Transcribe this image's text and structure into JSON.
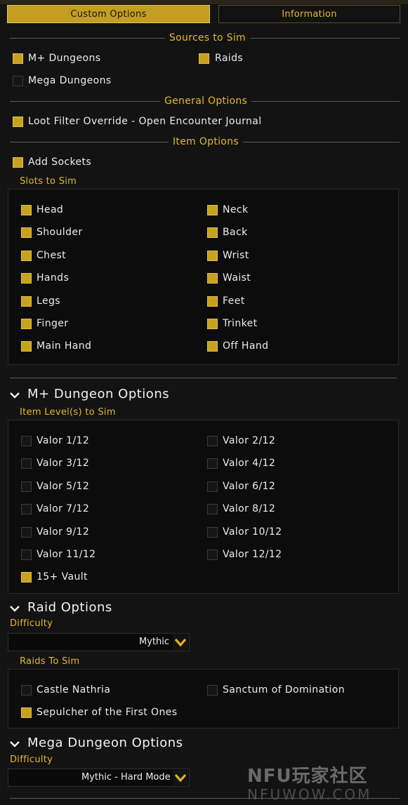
{
  "tabs": {
    "custom_options": "Custom Options",
    "information": "Information"
  },
  "sources": {
    "title": "Sources to Sim",
    "mplus": {
      "label": "M+ Dungeons",
      "checked": true
    },
    "raids": {
      "label": "Raids",
      "checked": true
    },
    "mega": {
      "label": "Mega Dungeons",
      "checked": false
    }
  },
  "general": {
    "title": "General Options",
    "loot_filter": {
      "label": "Loot Filter Override - Open Encounter Journal",
      "checked": true
    }
  },
  "item_options": {
    "title": "Item Options",
    "add_sockets": {
      "label": "Add Sockets",
      "checked": true
    },
    "slots_title": "Slots to Sim",
    "slots": [
      {
        "label": "Head",
        "checked": true
      },
      {
        "label": "Neck",
        "checked": true
      },
      {
        "label": "Shoulder",
        "checked": true
      },
      {
        "label": "Back",
        "checked": true
      },
      {
        "label": "Chest",
        "checked": true
      },
      {
        "label": "Wrist",
        "checked": true
      },
      {
        "label": "Hands",
        "checked": true
      },
      {
        "label": "Waist",
        "checked": true
      },
      {
        "label": "Legs",
        "checked": true
      },
      {
        "label": "Feet",
        "checked": true
      },
      {
        "label": "Finger",
        "checked": true
      },
      {
        "label": "Trinket",
        "checked": true
      },
      {
        "label": "Main Hand",
        "checked": true
      },
      {
        "label": "Off Hand",
        "checked": true
      }
    ]
  },
  "mplus_options": {
    "title": "M+ Dungeon Options",
    "ilvl_title": "Item Level(s) to Sim",
    "levels": [
      {
        "label": "Valor 1/12",
        "checked": false
      },
      {
        "label": "Valor 2/12",
        "checked": false
      },
      {
        "label": "Valor 3/12",
        "checked": false
      },
      {
        "label": "Valor 4/12",
        "checked": false
      },
      {
        "label": "Valor 5/12",
        "checked": false
      },
      {
        "label": "Valor 6/12",
        "checked": false
      },
      {
        "label": "Valor 7/12",
        "checked": false
      },
      {
        "label": "Valor 8/12",
        "checked": false
      },
      {
        "label": "Valor 9/12",
        "checked": false
      },
      {
        "label": "Valor 10/12",
        "checked": false
      },
      {
        "label": "Valor 11/12",
        "checked": false
      },
      {
        "label": "Valor 12/12",
        "checked": false
      },
      {
        "label": "15+ Vault",
        "checked": true
      }
    ]
  },
  "raid_options": {
    "title": "Raid Options",
    "difficulty_label": "Difficulty",
    "difficulty_value": "Mythic",
    "raids_title": "Raids To Sim",
    "raids": [
      {
        "label": "Castle Nathria",
        "checked": false
      },
      {
        "label": "Sanctum of Domination",
        "checked": false
      },
      {
        "label": "Sepulcher of the First Ones",
        "checked": true
      }
    ]
  },
  "mega_options": {
    "title": "Mega Dungeon Options",
    "difficulty_label": "Difficulty",
    "difficulty_value": "Mythic - Hard Mode"
  },
  "watermark": {
    "line1": "NFU玩家社区",
    "line2": "NFUWOW.COM"
  },
  "colors": {
    "accent": "#c8a21c",
    "heading": "#e3b92b",
    "panel": "#0c0c0c",
    "background": "#131313"
  }
}
